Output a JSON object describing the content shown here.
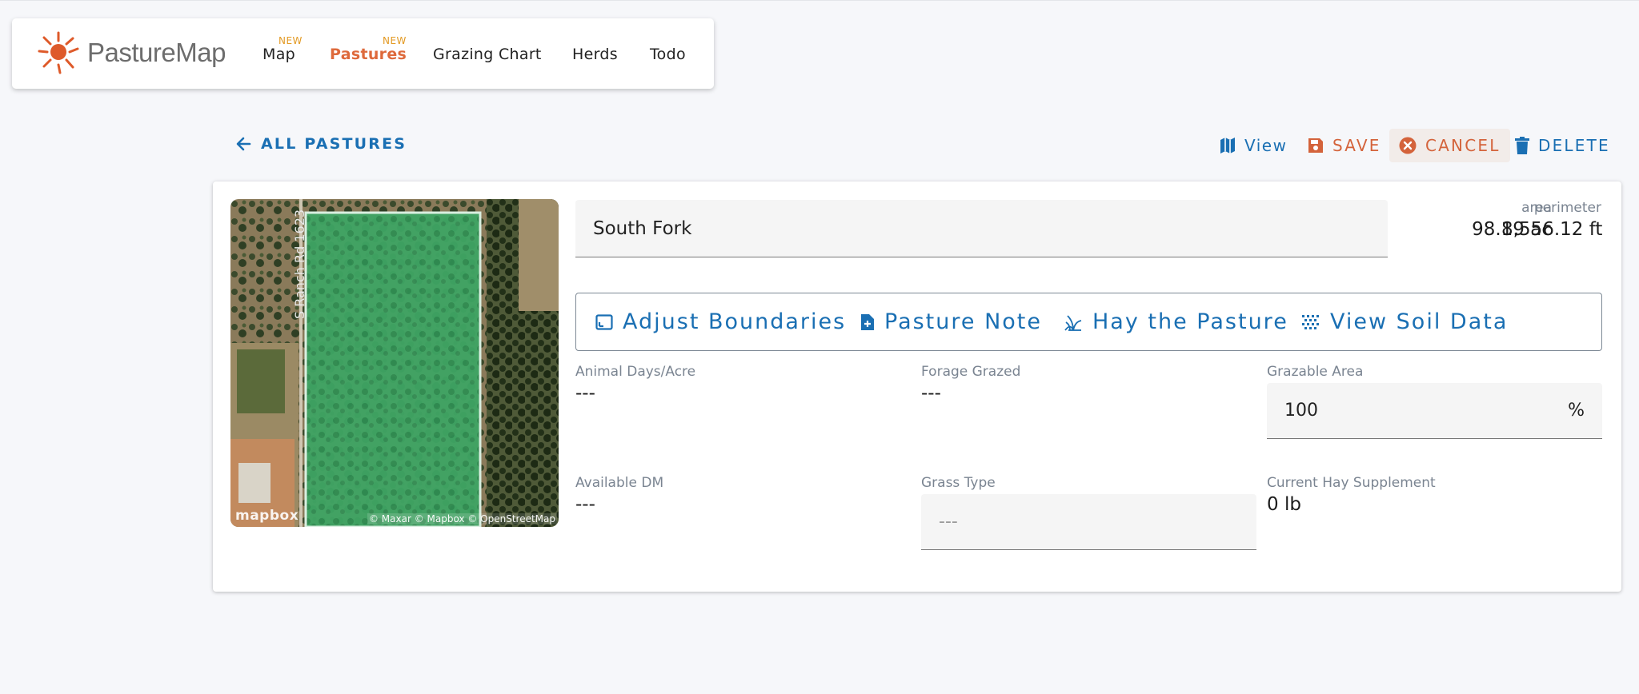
{
  "app": {
    "brand": "PastureMap"
  },
  "nav": {
    "items": [
      {
        "label": "Map",
        "badge": "NEW"
      },
      {
        "label": "Pastures",
        "badge": "NEW",
        "active": true
      },
      {
        "label": "Grazing Chart"
      },
      {
        "label": "Herds"
      },
      {
        "label": "Todo"
      }
    ]
  },
  "actions": {
    "back": "ALL PASTURES",
    "view": "View",
    "save": "SAVE",
    "cancel": "CANCEL",
    "delete": "DELETE"
  },
  "pasture": {
    "name": "South Fork",
    "area_label": "area",
    "area_value": "98.19 ac",
    "perimeter_label": "perimeter",
    "perimeter_value": "8,556.12 ft"
  },
  "map": {
    "road_label": "S Ranch Rd 1623",
    "logo": "mapbox",
    "credit": "© Maxar © Mapbox © OpenStreetMap"
  },
  "tools": {
    "adjust": "Adjust Boundaries",
    "note": "Pasture Note",
    "hay": "Hay the Pasture",
    "soil": "View Soil Data"
  },
  "fields": {
    "animal_days_label": "Animal Days/Acre",
    "animal_days_value": "---",
    "forage_grazed_label": "Forage Grazed",
    "forage_grazed_value": "---",
    "grazable_area_label": "Grazable Area",
    "grazable_area_value": "100",
    "grazable_area_unit": "%",
    "available_dm_label": "Available DM",
    "available_dm_value": "---",
    "grass_type_label": "Grass Type",
    "grass_type_placeholder": "---",
    "hay_supplement_label": "Current Hay Supplement",
    "hay_supplement_value": "0 lb"
  },
  "colors": {
    "primary_blue": "#1a6fb3",
    "accent_orange": "#d4633b",
    "badge_gold": "#e39a23",
    "pasture_green": "#2fa35f"
  }
}
